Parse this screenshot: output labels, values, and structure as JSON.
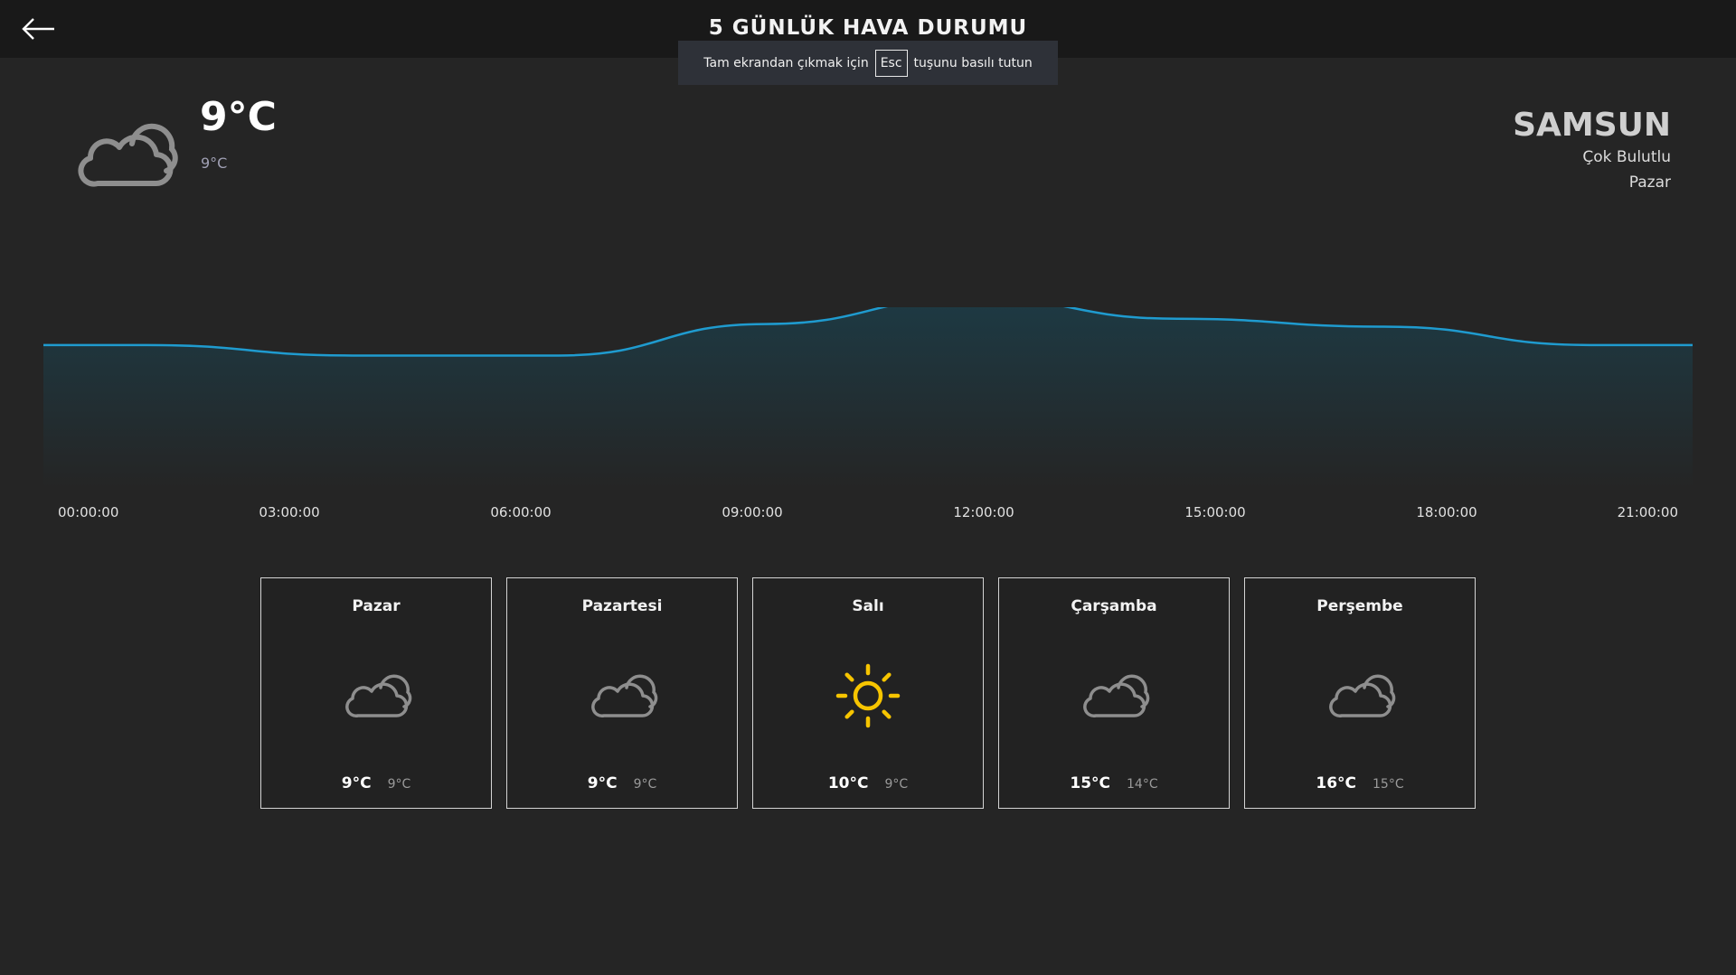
{
  "header": {
    "title": "5 GÜNLÜK HAVA DURUMU",
    "back_icon": "arrow-left-icon"
  },
  "fullscreen_toast": {
    "before": "Tam ekrandan çıkmak için",
    "key": "Esc",
    "after": "tuşunu basılı tutun"
  },
  "current": {
    "icon": "cloud-icon",
    "temp": "9°C",
    "feels": "9°C",
    "city": "SAMSUN",
    "condition": "Çok Bulutlu",
    "day": "Pazar"
  },
  "chart_data": {
    "type": "area",
    "x": [
      "00:00:00",
      "03:00:00",
      "06:00:00",
      "09:00:00",
      "12:00:00",
      "15:00:00",
      "18:00:00",
      "21:00:00"
    ],
    "series": [
      {
        "values": [
          9.4,
          9.0,
          9.0,
          10.2,
          11.2,
          10.4,
          10.1,
          9.4
        ]
      }
    ],
    "ylim": [
      0,
      16
    ],
    "line_color": "#1f9bcf",
    "fill_top_color": "#1d3a44",
    "fill_bottom_color": "#252525"
  },
  "forecast": [
    {
      "day": "Pazar",
      "icon": "cloud-icon",
      "hi": "9°C",
      "lo": "9°C"
    },
    {
      "day": "Pazartesi",
      "icon": "cloud-icon",
      "hi": "9°C",
      "lo": "9°C"
    },
    {
      "day": "Salı",
      "icon": "sun-icon",
      "hi": "10°C",
      "lo": "9°C"
    },
    {
      "day": "Çarşamba",
      "icon": "cloud-icon",
      "hi": "15°C",
      "lo": "14°C"
    },
    {
      "day": "Perşembe",
      "icon": "cloud-icon",
      "hi": "16°C",
      "lo": "15°C"
    }
  ],
  "colors": {
    "sun": "#f7c500",
    "cloud": "#8e8e8e"
  }
}
